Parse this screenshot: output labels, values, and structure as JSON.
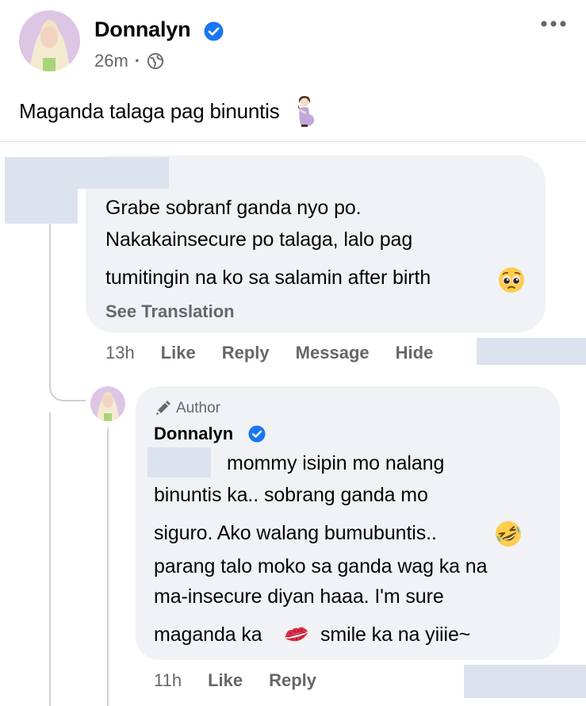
{
  "post": {
    "author": "Donnalyn",
    "time": "26m",
    "separator": "·",
    "text": "Maganda talaga pag binuntis"
  },
  "comment": {
    "lines": [
      "Grabe sobranf ganda nyo po.",
      "Nakakainsecure po talaga, lalo pag",
      "tumitingin na ko sa salamin after birth"
    ],
    "see_translation": "See Translation",
    "time": "13h",
    "actions": [
      "Like",
      "Reply",
      "Message",
      "Hide"
    ]
  },
  "reply": {
    "badge": "Author",
    "author": "Donnalyn",
    "lines": [
      "mommy isipin mo nalang",
      "binuntis ka.. sobrang ganda mo",
      "siguro. Ako walang bumubuntis..",
      "parang talo moko sa ganda wag ka na",
      "ma-insecure diyan haaa. I'm sure",
      "maganda ka",
      "smile ka na yiiie~"
    ],
    "time": "11h",
    "actions": [
      "Like",
      "Reply"
    ]
  },
  "colors": {
    "bubble": "#f0f2f5",
    "secondary_text": "#65676b",
    "verified": "#1877f2",
    "redaction": "#dde3ee"
  },
  "icons": [
    "verified-badge-icon",
    "globe-icon",
    "more-options-icon",
    "pregnant-woman-emoji",
    "pleading-face-emoji",
    "pen-icon",
    "rofl-emoji",
    "kiss-mark-emoji"
  ]
}
